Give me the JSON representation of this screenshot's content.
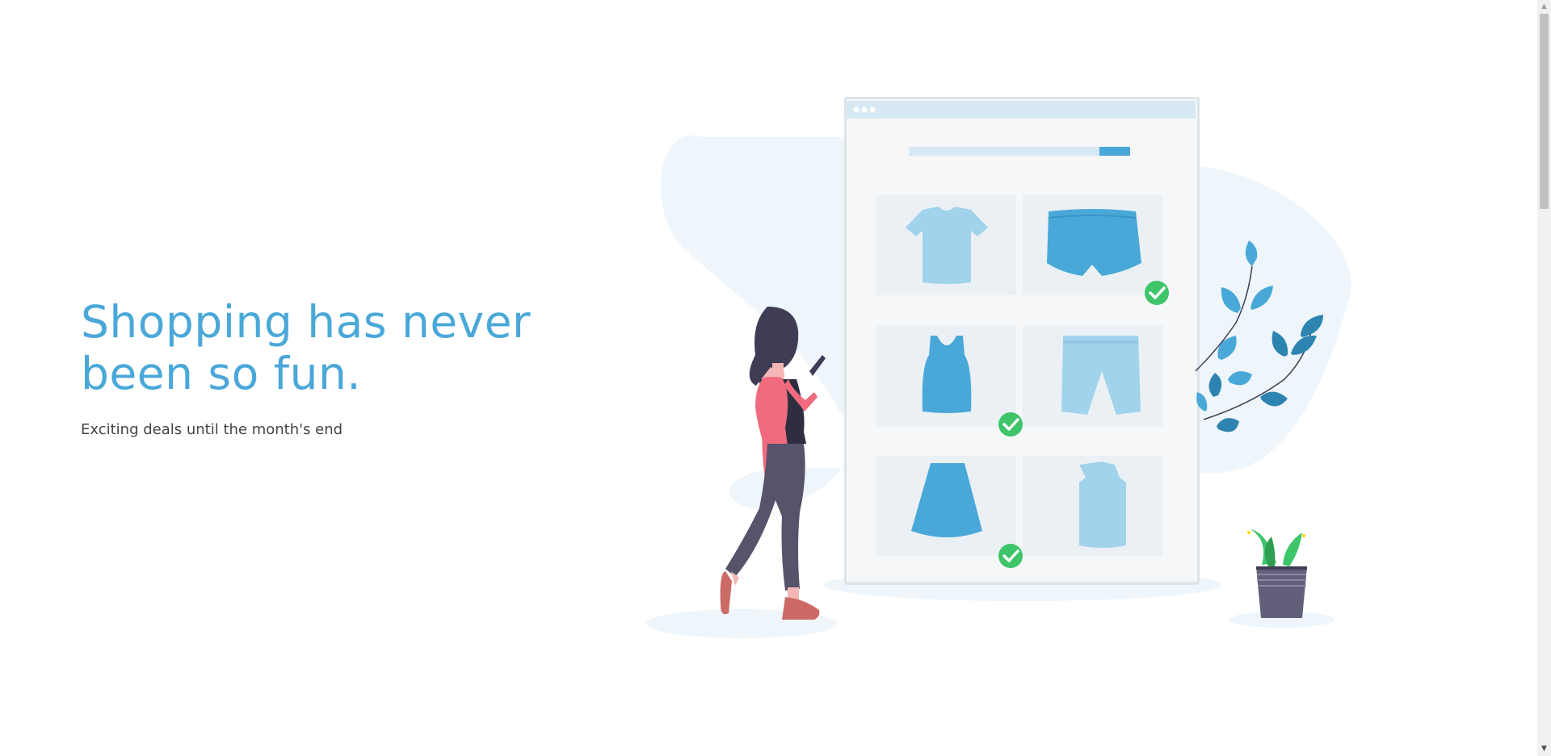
{
  "hero": {
    "headline": "Shopping has never been so fun.",
    "subheadline": "Exciting deals until the month's end"
  },
  "colors": {
    "accent": "#4aa8d8",
    "text": "#444444",
    "check": "#3ec56a",
    "jacket": "#f06b7e"
  },
  "icons": {
    "scroll_up": "▲",
    "scroll_down": "▼"
  }
}
